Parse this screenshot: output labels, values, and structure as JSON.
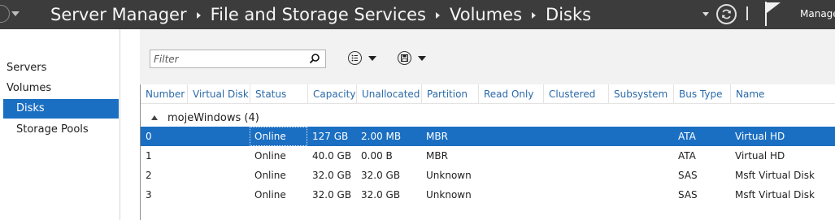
{
  "titlebar": {
    "breadcrumbs": [
      "Server Manager",
      "File and Storage Services",
      "Volumes",
      "Disks"
    ],
    "manage_label": "Manage"
  },
  "sidebar": {
    "items": [
      {
        "label": "Servers"
      },
      {
        "label": "Volumes"
      },
      {
        "label": "Disks",
        "selected": true
      },
      {
        "label": "Storage Pools"
      }
    ]
  },
  "toolbar": {
    "filter_placeholder": "Filter",
    "filter_value": ""
  },
  "table": {
    "columns": [
      "Number",
      "Virtual Disk",
      "Status",
      "Capacity",
      "Unallocated",
      "Partition",
      "Read Only",
      "Clustered",
      "Subsystem",
      "Bus Type",
      "Name"
    ],
    "group_label": "mojeWindows (4)",
    "rows": [
      {
        "number": "0",
        "virtual_disk": "",
        "status": "Online",
        "capacity": "127 GB",
        "unallocated": "2.00 MB",
        "partition": "MBR",
        "read_only": "",
        "clustered": "",
        "subsystem": "",
        "bus_type": "ATA",
        "name": "Virtual HD",
        "selected": true
      },
      {
        "number": "1",
        "virtual_disk": "",
        "status": "Online",
        "capacity": "40.0 GB",
        "unallocated": "0.00 B",
        "partition": "MBR",
        "read_only": "",
        "clustered": "",
        "subsystem": "",
        "bus_type": "ATA",
        "name": "Virtual HD",
        "selected": false
      },
      {
        "number": "2",
        "virtual_disk": "",
        "status": "Online",
        "capacity": "32.0 GB",
        "unallocated": "32.0 GB",
        "partition": "Unknown",
        "read_only": "",
        "clustered": "",
        "subsystem": "",
        "bus_type": "SAS",
        "name": "Msft Virtual Disk",
        "selected": false
      },
      {
        "number": "3",
        "virtual_disk": "",
        "status": "Online",
        "capacity": "32.0 GB",
        "unallocated": "32.0 GB",
        "partition": "Unknown",
        "read_only": "",
        "clustered": "",
        "subsystem": "",
        "bus_type": "SAS",
        "name": "Msft Virtual Disk",
        "selected": false
      }
    ]
  },
  "colors": {
    "titlebar_bg": "#3c3c3c",
    "selection": "#1b6fc2",
    "header_text": "#2a6aa8"
  },
  "icons": {
    "back": "back-arrow-icon",
    "refresh": "refresh-icon",
    "flag": "notification-flag-icon",
    "search": "search-icon",
    "list": "list-options-icon",
    "save": "save-query-icon"
  }
}
